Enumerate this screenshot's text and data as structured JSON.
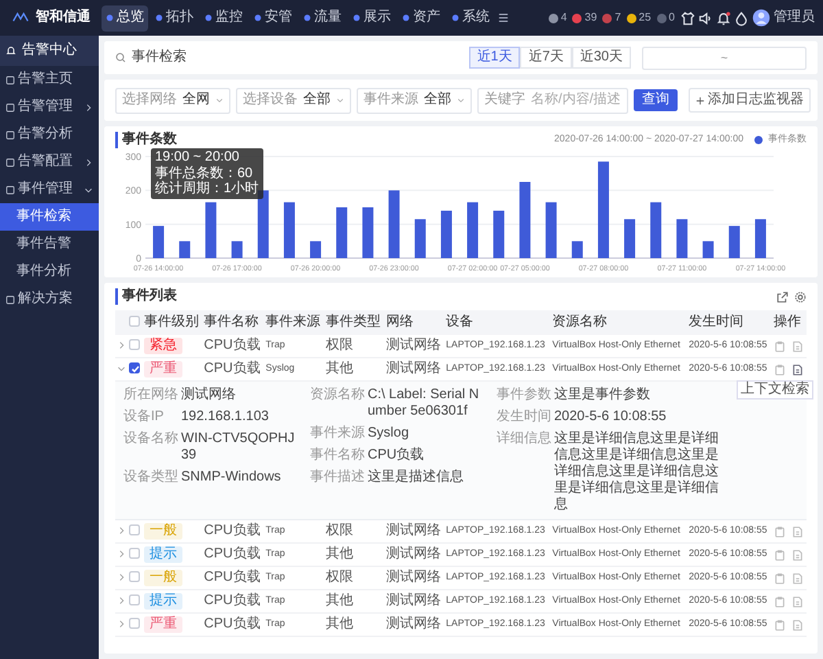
{
  "nav": {
    "logo": "智和信通",
    "menu": [
      {
        "label": "总览",
        "selected": true
      },
      {
        "label": "拓扑",
        "selected": false
      },
      {
        "label": "监控",
        "selected": false
      },
      {
        "label": "安管",
        "selected": false
      },
      {
        "label": "流量",
        "selected": false
      },
      {
        "label": "展示",
        "selected": false
      },
      {
        "label": "资产",
        "selected": false
      },
      {
        "label": "系统",
        "selected": false
      }
    ],
    "counters": [
      {
        "count": "4",
        "color": "#8c92a4"
      },
      {
        "count": "39",
        "color": "#e5414f"
      },
      {
        "count": "7",
        "color": "#c2424c"
      },
      {
        "count": "25",
        "color": "#e8b30b"
      },
      {
        "count": "0",
        "color": "#5c6378"
      }
    ],
    "user": "管理员"
  },
  "sidebar": {
    "title": "告警中心",
    "items": [
      {
        "label": "告警主页",
        "selected": false
      },
      {
        "label": "告警管理",
        "selected": false,
        "expanded": false
      },
      {
        "label": "告警分析",
        "selected": false
      },
      {
        "label": "告警配置",
        "selected": false,
        "expanded": false
      },
      {
        "label": "事件管理",
        "selected": false,
        "expanded": true,
        "children": [
          {
            "label": "事件检索",
            "selected": true
          },
          {
            "label": "事件告警",
            "selected": false
          },
          {
            "label": "事件分析",
            "selected": false
          }
        ]
      },
      {
        "label": "解决方案",
        "selected": false
      }
    ]
  },
  "page_header": {
    "title": "事件检索",
    "ranges": [
      {
        "label": "近1天",
        "selected": true
      },
      {
        "label": "近7天",
        "selected": false
      },
      {
        "label": "近30天",
        "selected": false
      }
    ],
    "date_range": {
      "separator": "~"
    }
  },
  "filters": [
    {
      "kind": "select",
      "label": "选择网络",
      "value": "全网"
    },
    {
      "kind": "select",
      "label": "选择设备",
      "value": "全部"
    },
    {
      "kind": "select",
      "label": "事件来源",
      "value": "全部"
    },
    {
      "kind": "text",
      "label": "关键字",
      "placeholder": "名称/内容/描述"
    }
  ],
  "search_button": "查询",
  "add_button": "添加日志监视器",
  "chart_section": {
    "title": "事件条数",
    "period": "2020-07-26 14:00:00 ~ 2020-07-27 14:00:00",
    "chart_data": {
      "type": "bar",
      "categories": [
        "07-26 14:00:00",
        null,
        null,
        "07-26 17:00:00",
        null,
        null,
        "07-26 20:00:00",
        null,
        null,
        "07-26 23:00:00",
        null,
        null,
        "07-27 02:00:00",
        null,
        "07-27 05:00:00",
        null,
        null,
        "07-27 08:00:00",
        null,
        null,
        "07-27 11:00:00",
        null,
        null,
        "07-27 14:00:00"
      ],
      "series": [
        {
          "name": "事件条数",
          "color": "#3f5bd8",
          "values": [
            95,
            50,
            165,
            50,
            200,
            165,
            50,
            150,
            150,
            200,
            115,
            140,
            165,
            140,
            225,
            165,
            50,
            285,
            115,
            165,
            115,
            50,
            95,
            115
          ]
        }
      ],
      "ylim": [
        0,
        300
      ],
      "yticks": [
        0,
        100,
        200,
        300
      ]
    },
    "tooltip": {
      "title": "19:00 ~ 20:00",
      "lines": [
        "事件总条数：60",
        "统计周期：1小时"
      ]
    }
  },
  "table": {
    "title": "事件列表",
    "header_checked": false,
    "columns": [
      "事件级别",
      "事件名称",
      "事件来源",
      "事件类型",
      "网络",
      "设备",
      "资源名称",
      "发生时间",
      "操作"
    ],
    "rows": [
      {
        "expanded": false,
        "checked": false,
        "level": "紧急",
        "color": "#f5222d",
        "name": "CPU负载",
        "source": "Trap",
        "type": "权限",
        "network": "测试网络",
        "device": "LAPTOP_192.168.1.23",
        "resource": "VirtualBox Host-Only Ethernet",
        "time": "2020-5-6 10:08:55"
      },
      {
        "expanded": true,
        "checked": true,
        "level": "严重",
        "color": "#eb5a75",
        "name": "CPU负载",
        "source": "Syslog",
        "type": "其他",
        "network": "测试网络",
        "device": "LAPTOP_192.168.1.23",
        "resource": "VirtualBox Host-Only Ethernet",
        "time": "2020-5-6 10:08:55",
        "action_tooltip": "上下文检索",
        "detail": [
          [
            {
              "label": "所在网络",
              "value": "测试网络"
            },
            {
              "label": "设备IP",
              "value": "192.168.1.103"
            },
            {
              "label": "设备名称",
              "value": "WIN-CTV5QOPHJ39"
            },
            {
              "label": "设备类型",
              "value": "SNMP-Windows"
            }
          ],
          [
            {
              "label": "资源名称",
              "value": "C:\\ Label:  Serial Number 5e06301f"
            },
            {
              "label": "事件来源",
              "value": "Syslog"
            },
            {
              "label": "事件名称",
              "value": "CPU负载"
            },
            {
              "label": "事件描述",
              "value": "这里是描述信息"
            }
          ],
          [
            {
              "label": "事件参数",
              "value": "这里是事件参数"
            },
            {
              "label": "发生时间",
              "value": "2020-5-6 10:08:55"
            },
            {
              "label": "详细信息",
              "value": "这里是详细信息这里是详细信息这里是详细信息这里是详细信息这里是详细信息这里是详细信息这里是详细信息"
            }
          ]
        ]
      },
      {
        "expanded": false,
        "checked": false,
        "level": "一般",
        "color": "#d9a406",
        "name": "CPU负载",
        "source": "Trap",
        "type": "权限",
        "network": "测试网络",
        "device": "LAPTOP_192.168.1.23",
        "resource": "VirtualBox Host-Only Ethernet",
        "time": "2020-5-6 10:08:55"
      },
      {
        "expanded": false,
        "checked": false,
        "level": "提示",
        "color": "#1d8fe0",
        "name": "CPU负载",
        "source": "Trap",
        "type": "其他",
        "network": "测试网络",
        "device": "LAPTOP_192.168.1.23",
        "resource": "VirtualBox Host-Only Ethernet",
        "time": "2020-5-6 10:08:55"
      },
      {
        "expanded": false,
        "checked": false,
        "level": "一般",
        "color": "#d9a406",
        "name": "CPU负载",
        "source": "Trap",
        "type": "权限",
        "network": "测试网络",
        "device": "LAPTOP_192.168.1.23",
        "resource": "VirtualBox Host-Only Ethernet",
        "time": "2020-5-6 10:08:55"
      },
      {
        "expanded": false,
        "checked": false,
        "level": "提示",
        "color": "#1d8fe0",
        "name": "CPU负载",
        "source": "Trap",
        "type": "其他",
        "network": "测试网络",
        "device": "LAPTOP_192.168.1.23",
        "resource": "VirtualBox Host-Only Ethernet",
        "time": "2020-5-6 10:08:55"
      },
      {
        "expanded": false,
        "checked": false,
        "level": "严重",
        "color": "#eb5a75",
        "name": "CPU负载",
        "source": "Trap",
        "type": "其他",
        "network": "测试网络",
        "device": "LAPTOP_192.168.1.23",
        "resource": "VirtualBox Host-Only Ethernet",
        "time": "2020-5-6 10:08:55"
      }
    ]
  }
}
